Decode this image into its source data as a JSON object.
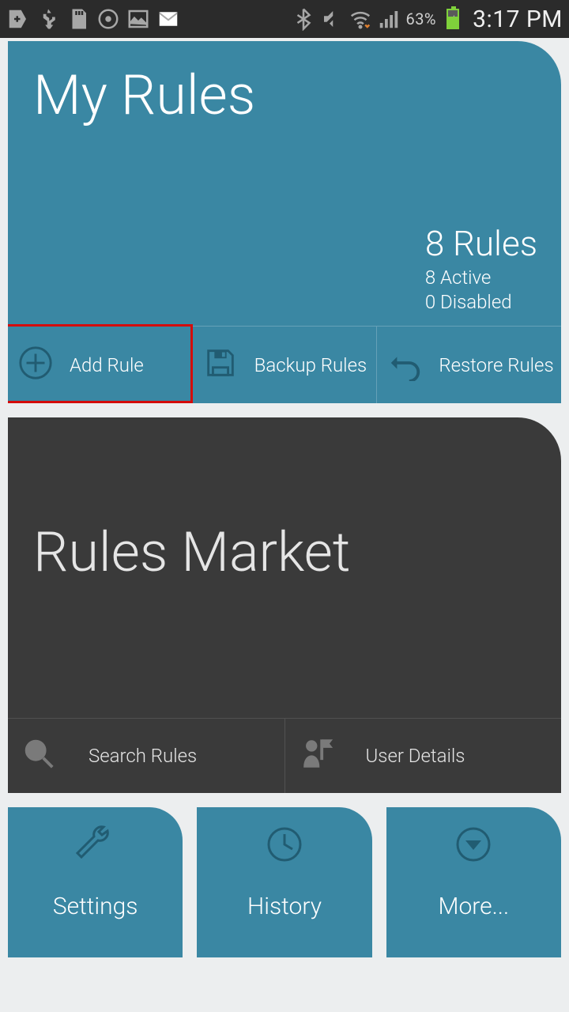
{
  "statusbar": {
    "battery_pct": "63%",
    "time": "3:17 PM"
  },
  "myrules": {
    "title": "My Rules",
    "count_label": "8 Rules",
    "active_label": "8 Active",
    "disabled_label": "0 Disabled",
    "actions": {
      "add": "Add Rule",
      "backup": "Backup Rules",
      "restore": "Restore Rules"
    }
  },
  "market": {
    "title": "Rules Market",
    "actions": {
      "search": "Search Rules",
      "user": "User Details"
    }
  },
  "tiles": {
    "settings": "Settings",
    "history": "History",
    "more": "More..."
  }
}
